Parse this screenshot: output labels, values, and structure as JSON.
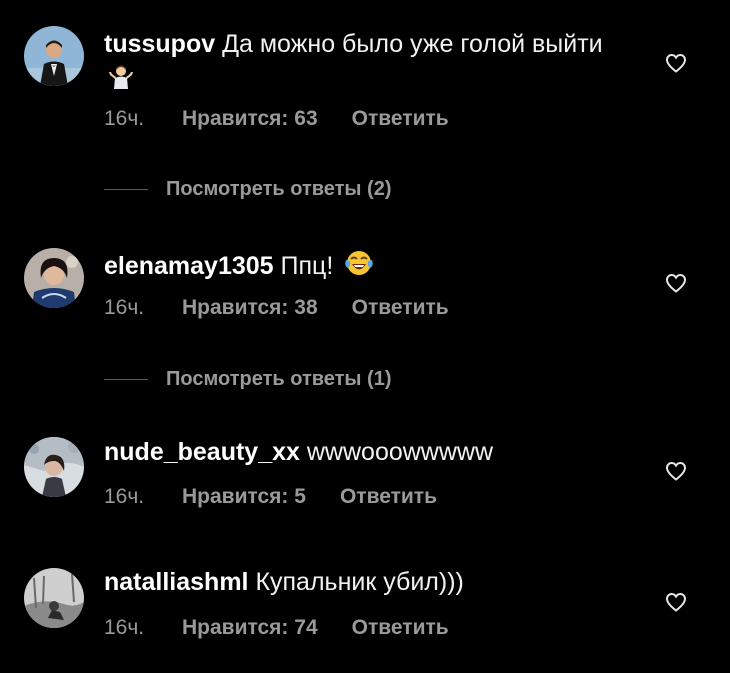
{
  "comments": [
    {
      "username": "tussupov",
      "text": "Да можно было уже голой выйти",
      "emoji": "person-shrugging",
      "time": "16ч.",
      "likes": "Нравится: 63",
      "reply": "Ответить",
      "view_replies": "Посмотреть ответы (2)"
    },
    {
      "username": "elenamay1305",
      "text": "Ппц!",
      "emoji": "face-with-tears-of-joy",
      "time": "16ч.",
      "likes": "Нравится: 38",
      "reply": "Ответить",
      "view_replies": "Посмотреть ответы (1)"
    },
    {
      "username": "nude_beauty_xx",
      "text": "wwwooowwwww",
      "time": "16ч.",
      "likes": "Нравится: 5",
      "reply": "Ответить"
    },
    {
      "username": "natalliashml",
      "text": "Купальник убил)))",
      "time": "16ч.",
      "likes": "Нравится: 74",
      "reply": "Ответить"
    }
  ],
  "icons": {
    "like": "heart-outline-icon"
  },
  "colors": {
    "background": "#000000",
    "primary_text": "#ffffff",
    "secondary_text": "#9a9a9a"
  }
}
